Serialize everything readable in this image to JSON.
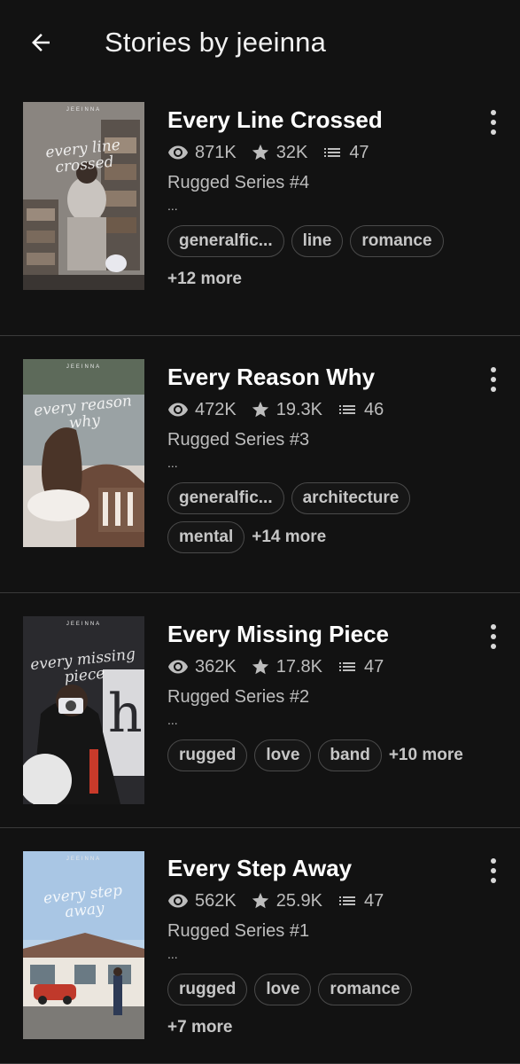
{
  "header": {
    "title": "Stories by jeeinna",
    "back_icon": "arrow-left-icon"
  },
  "colors": {
    "background": "#121212",
    "text_primary": "#ffffff",
    "text_secondary": "#bdbdbd",
    "divider": "#3a3a3a",
    "tag_border": "#4a4a4a"
  },
  "stories": [
    {
      "title": "Every Line Crossed",
      "reads": "871K",
      "votes": "32K",
      "parts": "47",
      "subtitle": "Rugged Series #4",
      "description": "...",
      "tags": [
        "generalfic...",
        "line",
        "romance"
      ],
      "more": "+12 more",
      "cover": {
        "author": "JEEINNA",
        "title": "every line crossed"
      }
    },
    {
      "title": "Every Reason Why",
      "reads": "472K",
      "votes": "19.3K",
      "parts": "46",
      "subtitle": "Rugged Series #3",
      "description": "...",
      "tags": [
        "generalfic...",
        "architecture",
        "mental"
      ],
      "more": "+14 more",
      "cover": {
        "author": "JEEINNA",
        "title": "every reason why"
      }
    },
    {
      "title": "Every Missing Piece",
      "reads": "362K",
      "votes": "17.8K",
      "parts": "47",
      "subtitle": "Rugged Series #2",
      "description": "...",
      "tags": [
        "rugged",
        "love",
        "band"
      ],
      "more": "+10 more",
      "cover": {
        "author": "JEEINNA",
        "title": "every missing piece"
      }
    },
    {
      "title": "Every Step Away",
      "reads": "562K",
      "votes": "25.9K",
      "parts": "47",
      "subtitle": "Rugged Series #1",
      "description": "...",
      "tags": [
        "rugged",
        "love",
        "romance"
      ],
      "more": "+7 more",
      "cover": {
        "author": "JEEINNA",
        "title": "every step away"
      }
    }
  ]
}
